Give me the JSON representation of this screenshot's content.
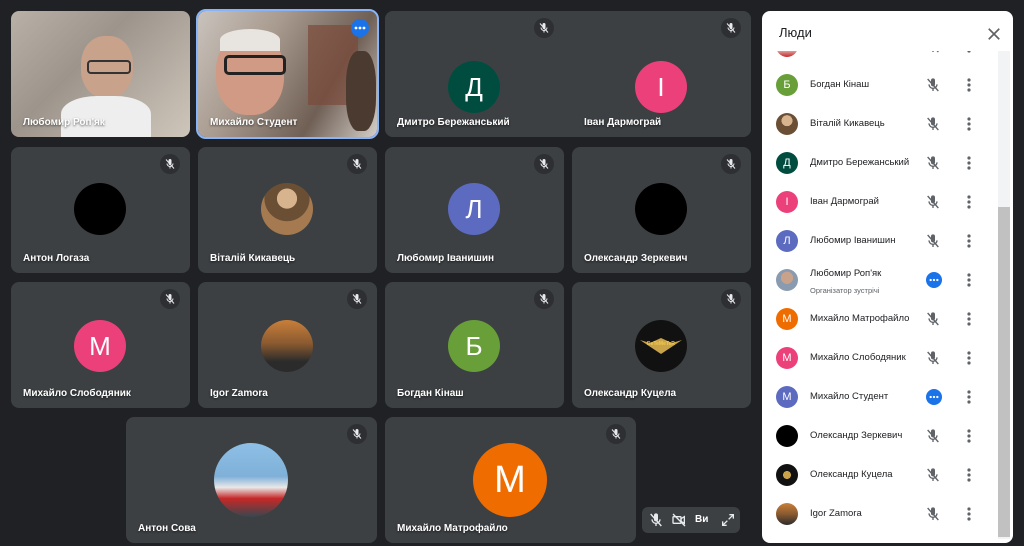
{
  "tiles": [
    {
      "name": "Любомир Роп'як"
    },
    {
      "name": "Михайло Студент"
    },
    {
      "name": "Дмитро Бережанський",
      "initial": "Д",
      "color": "#004d40"
    },
    {
      "name": "Іван Дармограй",
      "initial": "І",
      "color": "#ec407a"
    },
    {
      "name": "Антон Логаза"
    },
    {
      "name": "Віталій Кикавець"
    },
    {
      "name": "Любомир Іванишин",
      "initial": "Л",
      "color": "#5c6bc0"
    },
    {
      "name": "Олександр Зеркевич"
    },
    {
      "name": "Михайло Слободяник",
      "initial": "М",
      "color": "#ec407a"
    },
    {
      "name": "Igor Zamora"
    },
    {
      "name": "Богдан Кінаш",
      "initial": "Б",
      "color": "#689f38"
    },
    {
      "name": "Олександр Куцела",
      "badge": "DeTeMeTeR"
    },
    {
      "name": "Антон Сова"
    },
    {
      "name": "Михайло Матрофайло",
      "initial": "М",
      "color": "#ef6c00"
    }
  ],
  "panel": {
    "title": "Люди",
    "people": [
      {
        "name": "Антон Сова",
        "type": "photo"
      },
      {
        "name": "Богдан Кінаш",
        "initial": "Б",
        "color": "#689f38"
      },
      {
        "name": "Віталій Кикавець",
        "type": "photo"
      },
      {
        "name": "Дмитро Бережанський",
        "initial": "Д",
        "color": "#004d40"
      },
      {
        "name": "Іван Дармограй",
        "initial": "І",
        "color": "#ec407a"
      },
      {
        "name": "Любомир Іванишин",
        "initial": "Л",
        "color": "#5c6bc0"
      },
      {
        "name": "Любомир Роп'як",
        "sub": "Організатор зустрічі",
        "type": "photo",
        "more": true
      },
      {
        "name": "Михайло Матрофайло",
        "initial": "М",
        "color": "#ef6c00"
      },
      {
        "name": "Михайло Слободяник",
        "initial": "М",
        "color": "#ec407a"
      },
      {
        "name": "Михайло Студент",
        "initial": "М",
        "color": "#5c6bc0",
        "more": true
      },
      {
        "name": "Олександр Зеркевич",
        "initial": "",
        "color": "#000000"
      },
      {
        "name": "Олександр Куцела",
        "type": "photo"
      },
      {
        "name": "Igor Zamora",
        "type": "photo"
      }
    ]
  },
  "self_view": {
    "label": "Ви"
  }
}
